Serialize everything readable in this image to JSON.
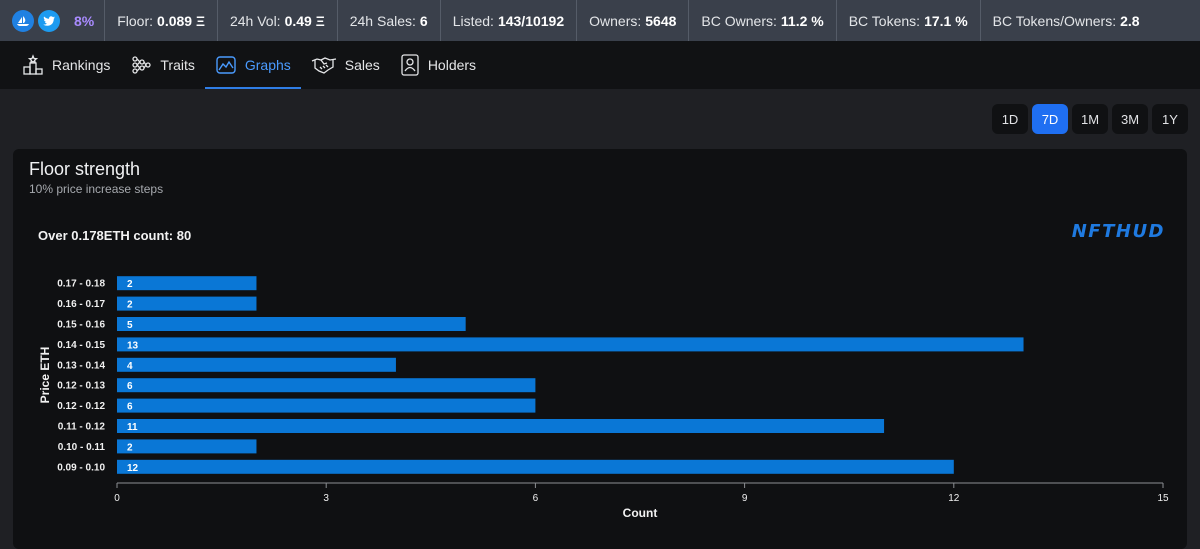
{
  "stats": {
    "percent": "8%",
    "floor_label": "Floor:",
    "floor_value": "0.089 Ξ",
    "vol_label": "24h Vol:",
    "vol_value": "0.49 Ξ",
    "sales_label": "24h Sales:",
    "sales_value": "6",
    "listed_label": "Listed:",
    "listed_value": "143/10192",
    "owners_label": "Owners:",
    "owners_value": "5648",
    "bc_owners_label": "BC Owners:",
    "bc_owners_value": "11.2 %",
    "bc_tokens_label": "BC Tokens:",
    "bc_tokens_value": "17.1 %",
    "bc_ratio_label": "BC Tokens/Owners:",
    "bc_ratio_value": "2.8"
  },
  "nav": {
    "items": [
      {
        "label": "Rankings",
        "icon": "podium-icon"
      },
      {
        "label": "Traits",
        "icon": "traits-icon"
      },
      {
        "label": "Graphs",
        "icon": "chart-icon"
      },
      {
        "label": "Sales",
        "icon": "handshake-icon"
      },
      {
        "label": "Holders",
        "icon": "holder-icon"
      }
    ],
    "active": "Graphs"
  },
  "ranges": [
    "1D",
    "7D",
    "1M",
    "3M",
    "1Y"
  ],
  "active_range": "7D",
  "card": {
    "title": "Floor strength",
    "subtitle": "10% price increase steps",
    "brand": "NFTHUD"
  },
  "colors": {
    "bar": "#0a77d6",
    "accent": "#1f6ff2",
    "brand": "#1f7ae0"
  },
  "chart_data": {
    "type": "bar",
    "orientation": "horizontal",
    "title": "Over 0.178ETH count: 80",
    "xlabel": "Count",
    "ylabel": "Price ETH",
    "xlim": [
      0,
      15
    ],
    "xticks": [
      0,
      3,
      6,
      9,
      12,
      15
    ],
    "categories": [
      "0.17 - 0.18",
      "0.16 - 0.17",
      "0.15 - 0.16",
      "0.14 - 0.15",
      "0.13 - 0.14",
      "0.12 - 0.13",
      "0.12 - 0.12",
      "0.11 - 0.12",
      "0.10 - 0.11",
      "0.09 - 0.10"
    ],
    "values": [
      2,
      2,
      5,
      13,
      4,
      6,
      6,
      11,
      2,
      12
    ],
    "grid": false
  }
}
